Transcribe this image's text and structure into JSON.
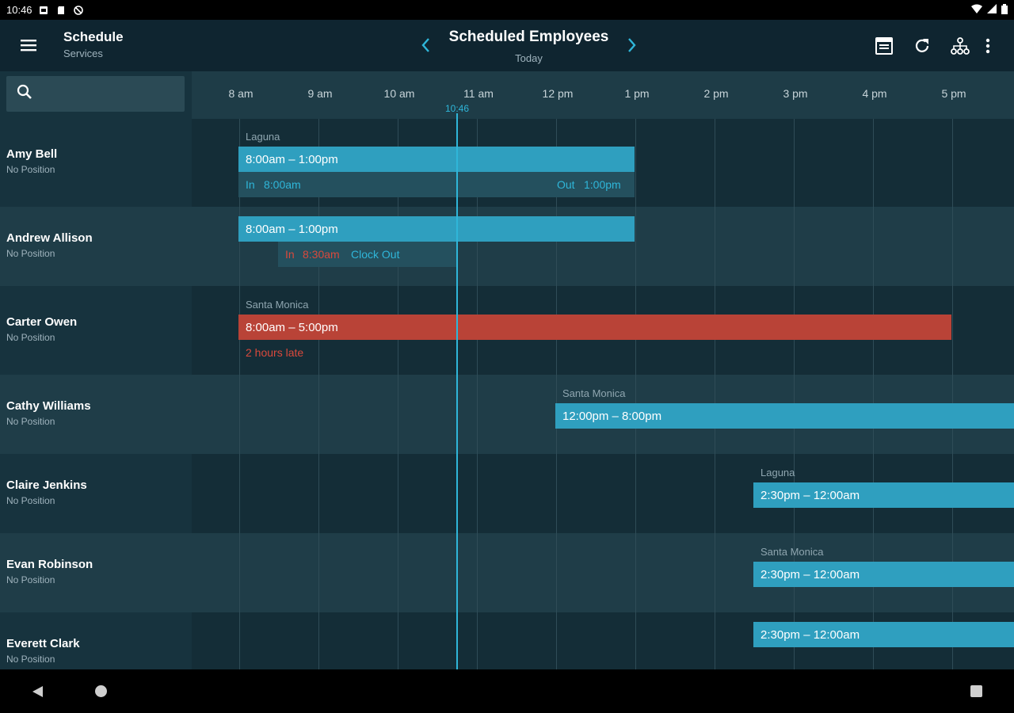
{
  "status_bar": {
    "time": "10:46"
  },
  "app_bar": {
    "title": "Schedule",
    "subtitle": "Services",
    "center_title": "Scheduled Employees",
    "center_subtitle": "Today"
  },
  "search": {
    "placeholder": ""
  },
  "timeline": {
    "hours": [
      "8 am",
      "9 am",
      "10 am",
      "11 am",
      "12 pm",
      "1 pm",
      "2 pm",
      "3 pm",
      "4 pm",
      "5 pm"
    ],
    "now_label": "10:46"
  },
  "colors": {
    "accent": "#2fb6d9",
    "shift": "#2f9fbf",
    "late": "#b94337",
    "background": "#0f2530"
  },
  "employees": [
    {
      "name": "Amy Bell",
      "position": "No Position",
      "location": "Laguna",
      "shift": "8:00am – 1:00pm",
      "clock_in_prefix": "In",
      "clock_in": "8:00am",
      "clock_out_prefix": "Out",
      "clock_out": "1:00pm"
    },
    {
      "name": "Andrew Allison",
      "position": "No Position",
      "shift": "8:00am – 1:00pm",
      "clock_in_prefix": "In",
      "clock_in": "8:30am",
      "clock_out_action": "Clock Out"
    },
    {
      "name": "Carter Owen",
      "position": "No Position",
      "location": "Santa Monica",
      "shift": "8:00am – 5:00pm",
      "status": "2 hours late"
    },
    {
      "name": "Cathy Williams",
      "position": "No Position",
      "location": "Santa Monica",
      "shift": "12:00pm – 8:00pm"
    },
    {
      "name": "Claire Jenkins",
      "position": "No Position",
      "location": "Laguna",
      "shift": "2:30pm – 12:00am"
    },
    {
      "name": "Evan Robinson",
      "position": "No Position",
      "location": "Santa Monica",
      "shift": "2:30pm – 12:00am"
    },
    {
      "name": "Everett Clark",
      "position": "No Position",
      "shift": "2:30pm – 12:00am"
    }
  ]
}
